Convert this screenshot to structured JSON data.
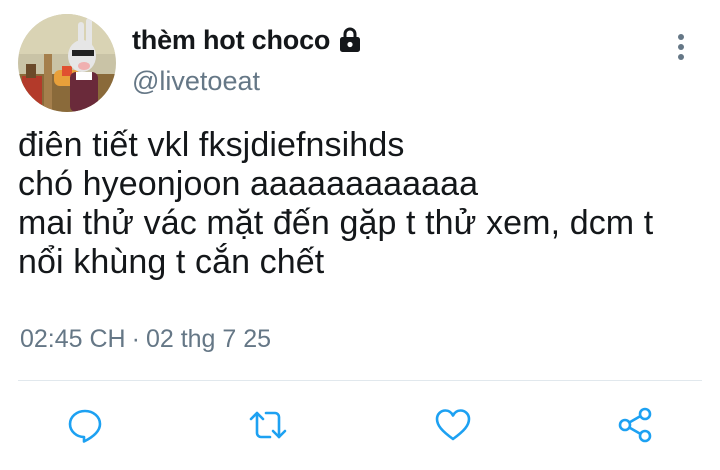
{
  "author": {
    "display_name": "thèm hot choco",
    "username": "@livetoeat",
    "avatar_icon": "cartoon-rabbit-avatar",
    "protected_icon": "lock-icon"
  },
  "tweet": {
    "lines": [
      "điên tiết vkl fksjdiefnsihds",
      "chó hyeonjoon aaaaaaaaaaaa",
      "mai thử vác mặt đến gặp t thử xem, dcm t",
      "nổi khùng t cắn chết"
    ]
  },
  "meta": {
    "time": "02:45 CH",
    "separator": "·",
    "date": "02 thg 7 25"
  },
  "actions": {
    "reply_icon": "reply-icon",
    "retweet_icon": "retweet-icon",
    "like_icon": "heart-icon",
    "share_icon": "share-icon"
  },
  "colors": {
    "text_primary": "#14171a",
    "text_secondary": "#657786",
    "icon_color": "#1da1f2",
    "divider": "#e1e8ed"
  }
}
